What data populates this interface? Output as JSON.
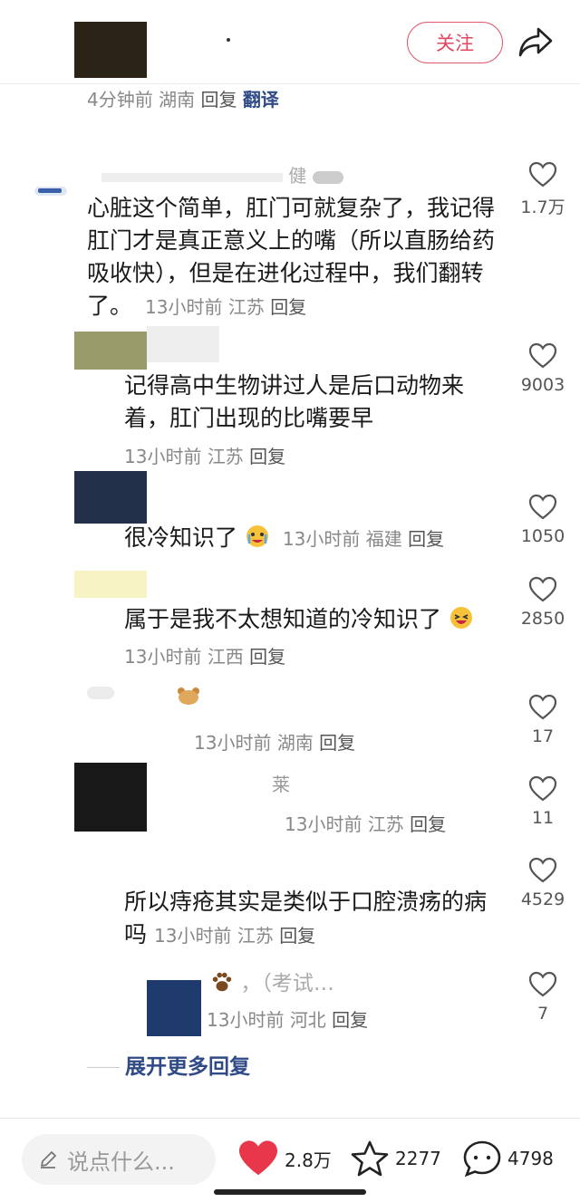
{
  "header": {
    "follow_label": "关注"
  },
  "top_comment_meta": {
    "time": "4分钟前",
    "location": "湖南",
    "reply": "回复",
    "translate": "翻译"
  },
  "comments": [
    {
      "name_fragment": "健",
      "text": "心脏这个简单，肛门可就复杂了，我记得肛门才是真正意义上的嘴（所以直肠给药吸收快），但是在进化过程中，我们翻转了。",
      "time": "13小时前",
      "location": "江苏",
      "reply": "回复",
      "likes": "1.7万"
    },
    {
      "name_fragment": "",
      "text": "记得高中生物讲过人是后口动物来着，肛门出现的比嘴要早",
      "time": "13小时前",
      "location": "江苏",
      "reply": "回复",
      "likes": "9003"
    },
    {
      "name_fragment": "",
      "text": "很冷知识了",
      "time": "13小时前",
      "location": "福建",
      "reply": "回复",
      "likes": "1050"
    },
    {
      "name_fragment": "",
      "text": "属于是我不太想知道的冷知识了",
      "time": "13小时前",
      "location": "江西",
      "reply": "回复",
      "likes": "2850"
    },
    {
      "name_fragment": "",
      "text": "",
      "time": "13小时前",
      "location": "湖南",
      "reply": "回复",
      "likes": "17"
    },
    {
      "name_fragment": "莱",
      "text": "",
      "time": "13小时前",
      "location": "江苏",
      "reply": "回复",
      "likes": "11"
    },
    {
      "name_fragment": "",
      "text": "所以痔疮其实是类似于口腔溃疡的病吗",
      "time": "13小时前",
      "location": "江苏",
      "reply": "回复",
      "likes": "4529"
    },
    {
      "name_fragment": "，（考试…",
      "text": "",
      "time": "13小时前",
      "location": "河北",
      "reply": "回复",
      "likes": "7"
    }
  ],
  "expand_label": "展开更多回复",
  "bottom_bar": {
    "input_placeholder": "说点什么...",
    "likes": "2.8万",
    "favorites": "2277",
    "comments": "4798"
  },
  "colors": {
    "accent_red": "#e8364a",
    "link_blue": "#2f4a86"
  },
  "icons": [
    "share-icon",
    "heart-outline-icon",
    "cry-laugh-emoji",
    "laughing-emoji",
    "paw-emoji",
    "edit-icon",
    "heart-filled-icon",
    "star-icon",
    "comment-bubble-icon"
  ]
}
